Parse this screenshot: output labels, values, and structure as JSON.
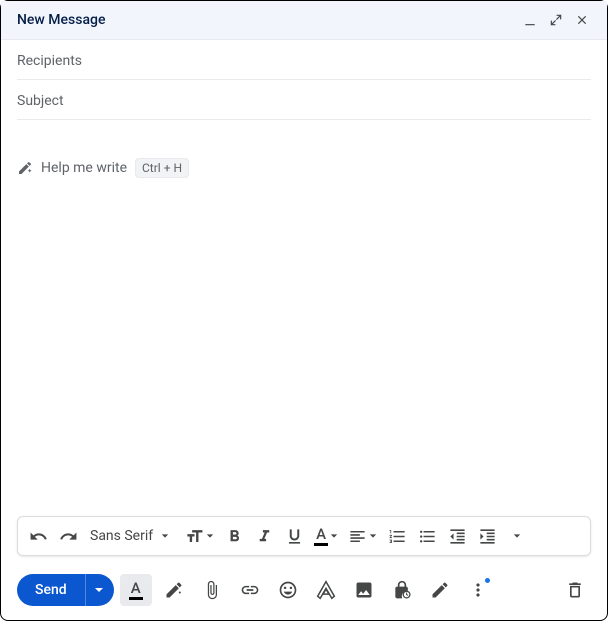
{
  "header": {
    "title": "New Message"
  },
  "fields": {
    "recipients_placeholder": "Recipients",
    "subject_placeholder": "Subject"
  },
  "body": {
    "help_write_label": "Help me write",
    "help_write_shortcut": "Ctrl + H"
  },
  "format": {
    "font": "Sans Serif"
  },
  "send": {
    "label": "Send"
  }
}
